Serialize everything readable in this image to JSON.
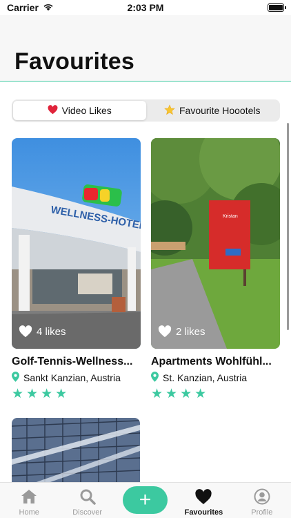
{
  "status_bar": {
    "carrier": "Carrier",
    "time": "2:03 PM"
  },
  "header": {
    "title": "Favourites"
  },
  "segmented_control": {
    "options": [
      {
        "label": "Video Likes",
        "icon": "heart-emoji-icon",
        "selected": true
      },
      {
        "label": "Favourite Hoootels",
        "icon": "star-emoji-icon",
        "selected": false
      }
    ]
  },
  "hotels": [
    {
      "name": "Golf-Tennis-Wellness-Hotel Moro",
      "name_display": "Golf-Tennis-Wellness...",
      "location": "Sankt Kanzian, Austria",
      "likes": "4 likes",
      "stars": 4
    },
    {
      "name": "Apartments Wohlfühl...",
      "name_display": "Apartments Wohlfühl...",
      "location": "St. Kanzian, Austria",
      "likes": "2 likes",
      "stars": 4
    }
  ],
  "tab_bar": {
    "tabs": [
      {
        "label": "Home",
        "icon": "house-icon"
      },
      {
        "label": "Discover",
        "icon": "search-icon"
      },
      {
        "label": "",
        "icon": "plus-icon"
      },
      {
        "label": "Favourites",
        "icon": "heart-icon",
        "active": true
      },
      {
        "label": "Profile",
        "icon": "person-circle-icon"
      }
    ]
  },
  "colors": {
    "accent": "#3cc9a0",
    "star": "#3cc9a0",
    "header_bg": "#f7f7f7"
  }
}
